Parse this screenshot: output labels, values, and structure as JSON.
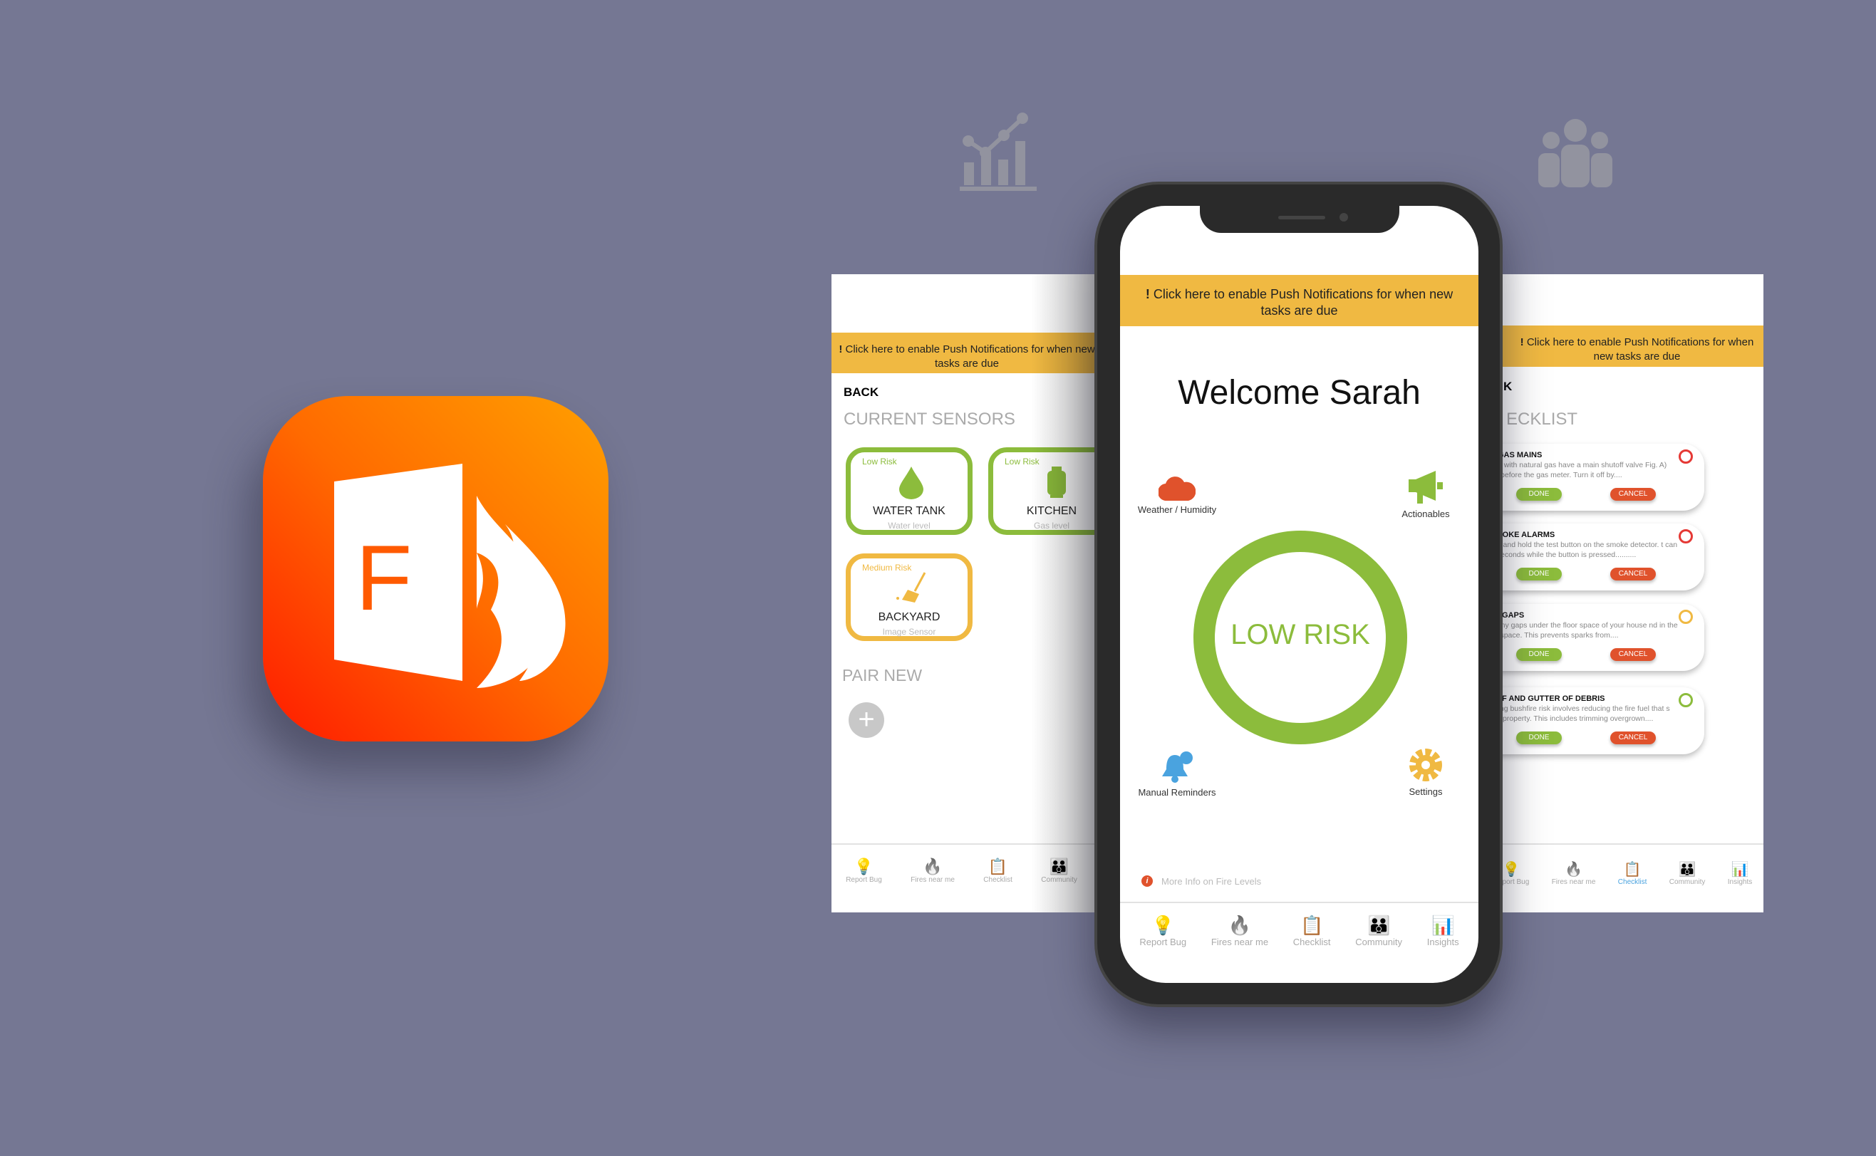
{
  "app_icon": {
    "letter": "F"
  },
  "colors": {
    "background": "#757793",
    "banner": "#f0b942",
    "low_risk": "#8cbc3c",
    "medium_risk": "#f0b942",
    "high": "#e53935",
    "cancel": "#e0522c"
  },
  "banner_text": "Click here to enable Push Notifications for when new tasks are due",
  "banner_mark": "!",
  "nav": [
    {
      "label": "Report Bug",
      "icon": "lightbulb-icon"
    },
    {
      "label": "Fires near me",
      "icon": "flame-icon"
    },
    {
      "label": "Checklist",
      "icon": "clipboard-icon"
    },
    {
      "label": "Community",
      "icon": "people-icon"
    },
    {
      "label": "Insights",
      "icon": "chart-icon"
    }
  ],
  "sensors_screen": {
    "back": "BACK",
    "title": "CURRENT SENSORS",
    "pair_new": "PAIR NEW",
    "sensors": [
      {
        "risk": "Low Risk",
        "name": "WATER TANK",
        "sub": "Water level",
        "icon": "water-drop-icon"
      },
      {
        "risk": "Low Risk",
        "name": "KITCHEN",
        "sub": "Gas level",
        "icon": "gas-cylinder-icon"
      },
      {
        "risk": "Medium Risk",
        "name": "BACKYARD",
        "sub": "Image Sensor",
        "icon": "broom-icon"
      }
    ]
  },
  "home_screen": {
    "welcome": "Welcome Sarah",
    "risk_label": "LOW RISK",
    "weather": "Weather / Humidity",
    "actionables": "Actionables",
    "reminders": "Manual Reminders",
    "settings": "Settings",
    "more_info": "More Info on Fire Levels"
  },
  "checklist_screen": {
    "back": "K",
    "title": "ECKLIST",
    "tasks": [
      {
        "title": "URN OFF GAS MAINS",
        "desc": "esc: Houses with natural gas have a main shutoff valve Fig. A) located just before the gas meter.  Turn it off by....",
        "status_color": "#e53935"
      },
      {
        "title": "CHECK SMOKE ALARMS",
        "desc": "Desc: Press and hold the test button on the smoke detector. t can take a few seconds while the button is pressed..........",
        "status_color": "#e53935"
      },
      {
        "title": "LOCK ALL GAPS",
        "desc": "esc: Block any gaps under the floor space of your house nd in the attic or roof space. This prevents sparks from....",
        "status_color": "#f0b942"
      },
      {
        "title": "LEAN ROOF AND GUTTER OF DEBRIS",
        "desc": "esc: Reducing bushfire risk involves reducing the fire fuel that s around your property. This includes trimming overgrown....",
        "status_color": "#8cbc3c"
      }
    ],
    "done": "DONE",
    "cancel": "CANCEL"
  }
}
